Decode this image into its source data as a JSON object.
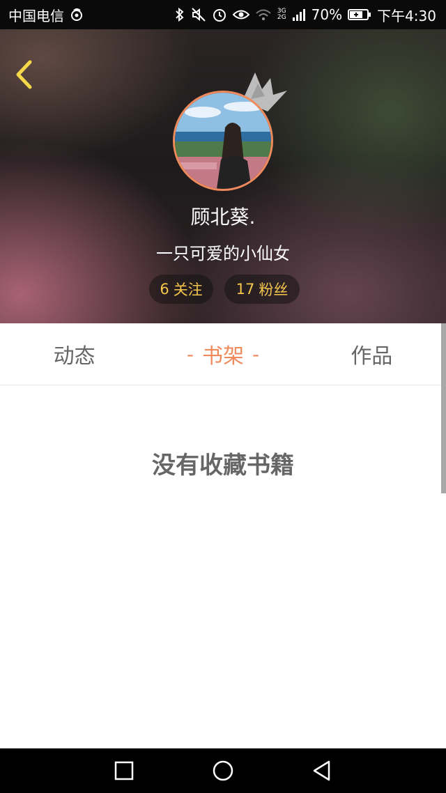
{
  "status_bar": {
    "carrier": "中国电信",
    "network_top": "3G",
    "network_bottom": "2G",
    "battery": "70%",
    "time": "下午4:30",
    "icons": [
      "weibo-icon",
      "bluetooth-icon",
      "mute-icon",
      "alarm-icon",
      "eye-icon",
      "wifi-icon",
      "signal-icon",
      "battery-icon"
    ]
  },
  "profile": {
    "username": "顾北葵.",
    "bio": "一只可爱的小仙女",
    "following_count": "6",
    "following_label": "关注",
    "fans_count": "17",
    "fans_label": "粉丝"
  },
  "tabs": [
    {
      "label": "动态",
      "active": false
    },
    {
      "label": "书架",
      "active": true
    },
    {
      "label": "作品",
      "active": false
    }
  ],
  "content": {
    "empty_message": "没有收藏书籍"
  },
  "colors": {
    "accent": "#f08a5d",
    "stat_text": "#f5c64d",
    "back_arrow": "#f5d84a",
    "avatar_border": "#ee8a5c"
  },
  "nav_bar": {
    "icons": [
      "square-recents-icon",
      "circle-home-icon",
      "triangle-back-icon"
    ]
  }
}
